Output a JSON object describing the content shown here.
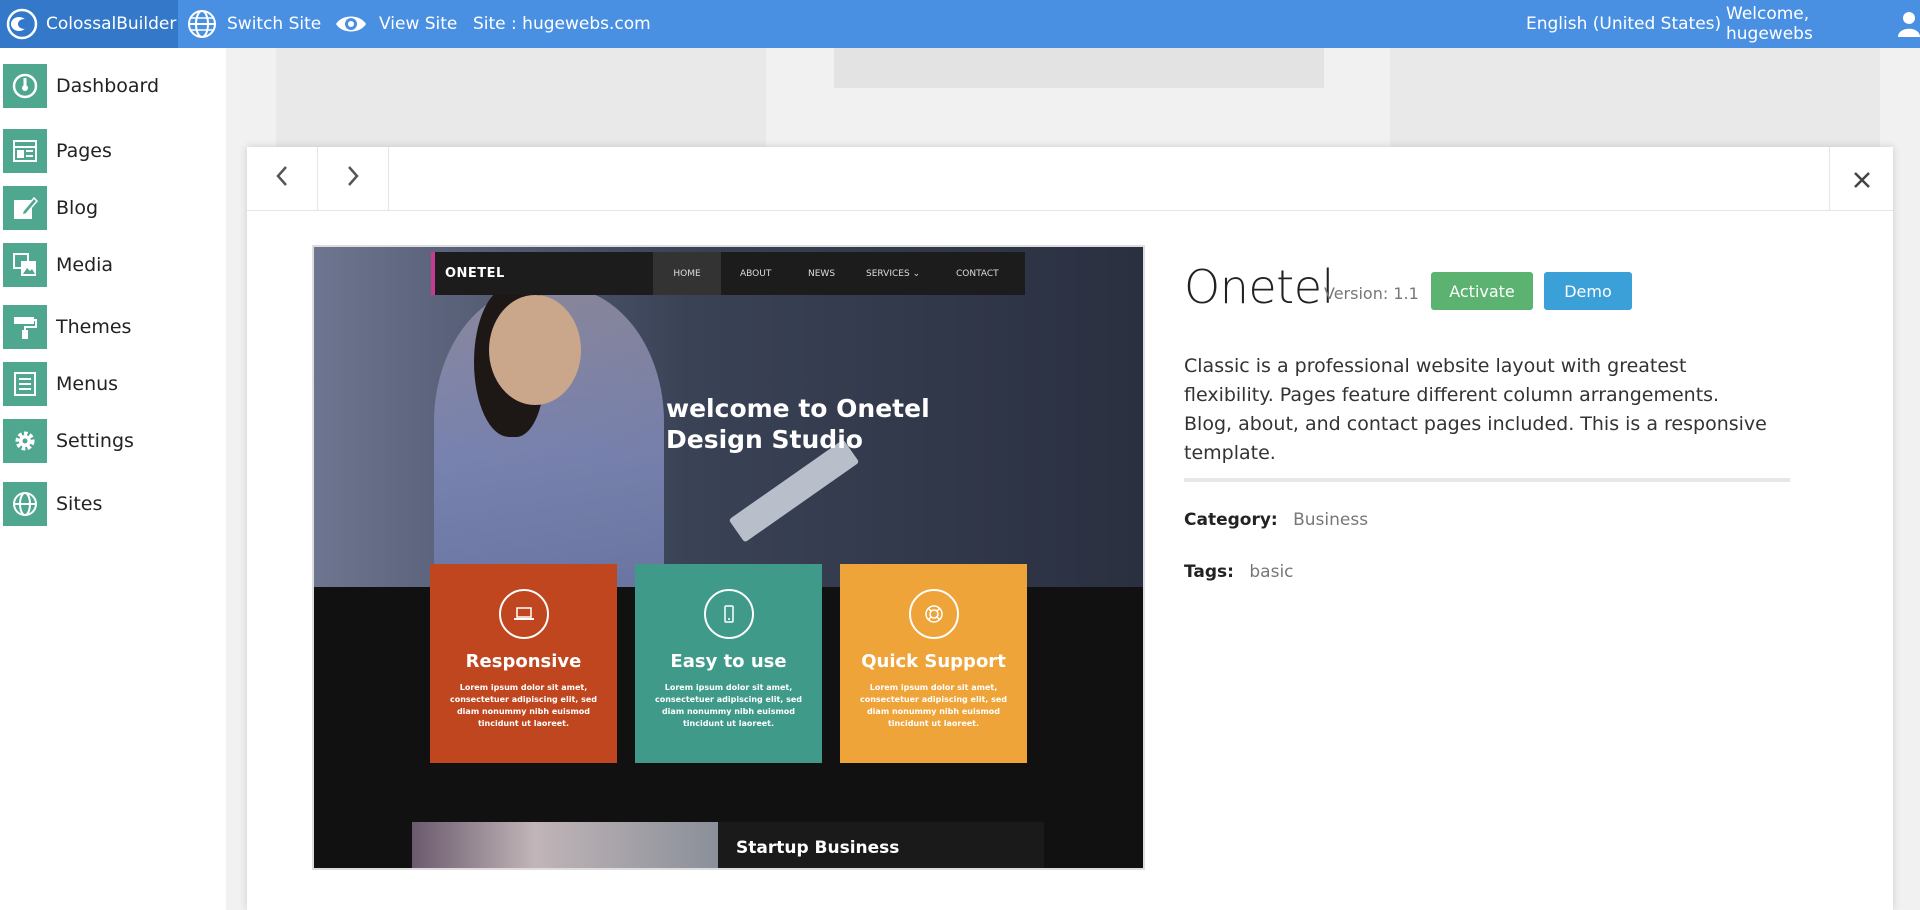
{
  "topbar": {
    "brand": "ColossalBuilder",
    "switch_site": "Switch Site",
    "view_site": "View Site",
    "site_label": "Site : hugewebs.com",
    "language": "English (United States)",
    "welcome": "Welcome, hugewebs"
  },
  "sidebar": {
    "items": [
      {
        "label": "Dashboard",
        "icon": "dashboard-icon"
      },
      {
        "label": "Pages",
        "icon": "pages-icon"
      },
      {
        "label": "Blog",
        "icon": "blog-icon"
      },
      {
        "label": "Media",
        "icon": "media-icon"
      },
      {
        "label": "Themes",
        "icon": "themes-icon"
      },
      {
        "label": "Menus",
        "icon": "menus-icon"
      },
      {
        "label": "Settings",
        "icon": "gear-icon"
      },
      {
        "label": "Sites",
        "icon": "globe-icon"
      }
    ]
  },
  "modal": {
    "theme": {
      "name": "Onetel",
      "version": "Version: 1.1",
      "activate_label": "Activate",
      "demo_label": "Demo",
      "description": "Classic is a professional website layout with greatest flexibility. Pages feature different column arrangements. Blog, about, and contact pages included. This is a responsive template.",
      "category_label": "Category:",
      "category_value": "Business",
      "tags_label": "Tags:",
      "tags_value": "basic"
    },
    "preview": {
      "logo": "ONETEL",
      "menu": [
        "HOME",
        "ABOUT",
        "NEWS",
        "SERVICES",
        "CONTACT"
      ],
      "hero_line1": "welcome to Onetel",
      "hero_line2": "Design Studio",
      "cards": [
        {
          "title": "Responsive",
          "text": "Lorem ipsum dolor sit amet, consectetuer adipiscing elit, sed diam nonummy nibh euismod tincidunt ut laoreet.",
          "color": "#c0461f"
        },
        {
          "title": "Easy to use",
          "text": "Lorem ipsum dolor sit amet, consectetuer adipiscing elit, sed diam nonummy nibh euismod tincidunt ut laoreet.",
          "color": "#3f9a89"
        },
        {
          "title": "Quick Support",
          "text": "Lorem ipsum dolor sit amet, consectetuer adipiscing elit, sed diam nonummy nibh euismod tincidunt ut laoreet.",
          "color": "#efa43a"
        }
      ],
      "bottom_title": "Startup Business"
    }
  },
  "colors": {
    "topbar": "#4a90e2",
    "sidebar_icon": "#4ea78e",
    "activate": "#5cb270",
    "demo": "#3b9fd8"
  }
}
